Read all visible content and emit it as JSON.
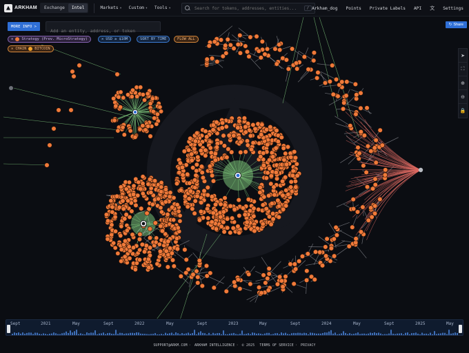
{
  "brand": {
    "name": "ARKHAM"
  },
  "mode_toggle": {
    "options": [
      "Exchange",
      "Intel"
    ],
    "active": "Intel"
  },
  "menu": [
    "Markets",
    "Custom",
    "Tools"
  ],
  "search": {
    "placeholder": "Search for tokens, addresses, entities...",
    "shortcut": "/"
  },
  "right_nav": {
    "user": "Arkham_dog",
    "points": "Points",
    "private_labels": "Private Labels",
    "api": "API",
    "settings": "Settings",
    "translate_icon": "translate-icon"
  },
  "controls": {
    "more_info": "MORE INFO >",
    "add_entity_placeholder": "Add an entity, address, or token",
    "share": "Share"
  },
  "filters": [
    {
      "label": "Strategy (Prev. MicroStrategy)",
      "color": "#8a66b8"
    },
    {
      "label": "USD ≥ $10M",
      "color": "#3d7fd9"
    },
    {
      "label": "SORT BY TIME",
      "color": "#3d7fd9"
    },
    {
      "label": "FLOW ALL",
      "color": "#d98a3d"
    },
    {
      "label": "CHAIN",
      "value": "BITCOIN",
      "color": "#d98a3d"
    }
  ],
  "toolbar_icons": [
    "cursor-icon",
    "fit-icon",
    "zoom-in-icon",
    "zoom-out-icon",
    "lock-icon"
  ],
  "timeline": {
    "labels": [
      "Sept",
      "2021",
      "May",
      "Sept",
      "2022",
      "May",
      "Sept",
      "2023",
      "May",
      "Sept",
      "2024",
      "May",
      "Sept",
      "2025",
      "May"
    ]
  },
  "footer": {
    "email": "SUPPORT@ARKM.COM",
    "company": "ARKHAM INTELLIGENCE",
    "copyright": "© 2025",
    "terms": "TERMS OF SERVICE",
    "privacy": "PRIVACY"
  },
  "colors": {
    "node": "#f07a3a",
    "inflow_edge": "#7cc279",
    "outflow_edge": "#e06b63",
    "neutral_edge": "#b9bcc3",
    "accent": "#2f6fd6"
  }
}
